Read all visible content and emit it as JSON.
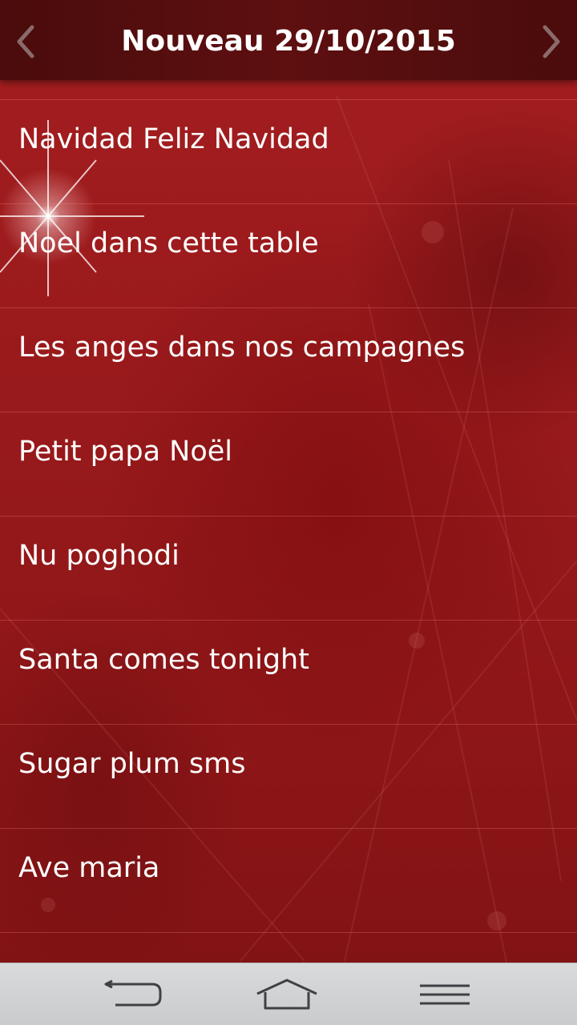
{
  "header": {
    "title": "Nouveau 29/10/2015",
    "prev_icon": "chevron-left-icon",
    "next_icon": "chevron-right-icon"
  },
  "songs": [
    {
      "label": "Navidad Feliz Navidad"
    },
    {
      "label": "Noel dans cette table"
    },
    {
      "label": "Les anges dans nos campagnes"
    },
    {
      "label": "Petit papa Noël"
    },
    {
      "label": "Nu poghodi"
    },
    {
      "label": "Santa comes tonight"
    },
    {
      "label": "Sugar plum sms"
    },
    {
      "label": "Ave maria"
    }
  ],
  "system_nav": {
    "back_icon": "back-arrow-icon",
    "home_icon": "home-icon",
    "menu_icon": "menu-icon"
  },
  "colors": {
    "background": "#9a1a1c",
    "header": "#560e0f",
    "text": "#ffffff",
    "navbar": "#d2d4d5"
  }
}
